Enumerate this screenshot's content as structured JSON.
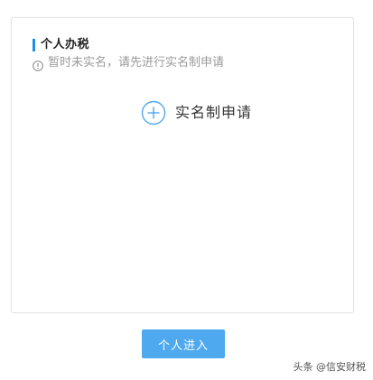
{
  "card": {
    "title": "个人办税",
    "notice": "暂时未实名，请先进行实名制申请",
    "apply_label": "实名制申请"
  },
  "actions": {
    "enter_label": "个人进入"
  },
  "watermark": {
    "text": "头条 @信安财税"
  },
  "icons": {
    "info": "info-circle-icon",
    "apply": "plus-circle-icon"
  },
  "colors": {
    "accent": "#1f8ee6",
    "button": "#4ea9ef",
    "muted_text": "#9a9a9a",
    "border": "#e3e3e3"
  }
}
